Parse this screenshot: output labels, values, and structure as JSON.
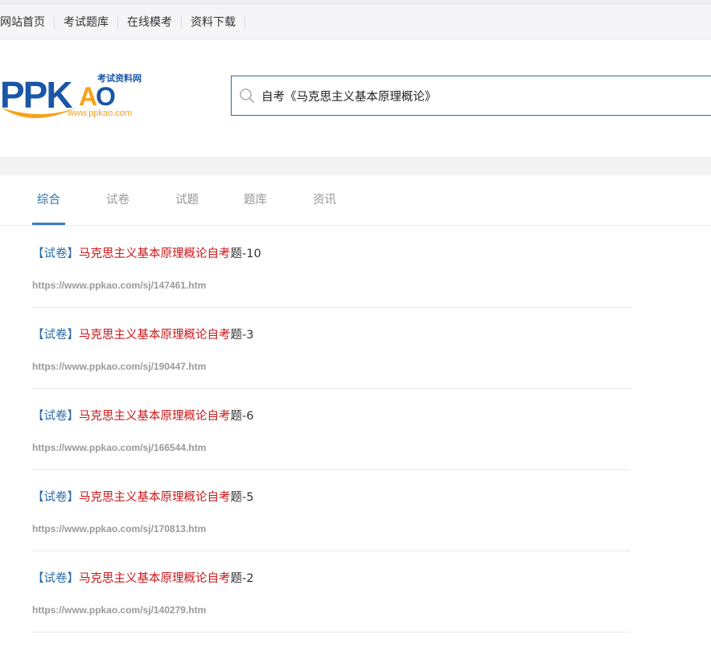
{
  "topnav": {
    "items": [
      "网站首页",
      "考试题库",
      "在线模考",
      "资料下载"
    ]
  },
  "logo": {
    "brand": "PPKAO",
    "tagline": "考试资料网",
    "url": "www.ppkao.com",
    "colors": {
      "blue": "#1a56a8",
      "orange": "#f4a31a"
    }
  },
  "search": {
    "value": "自考《马克思主义基本原理概论》",
    "icon": "search-icon"
  },
  "tabs": [
    {
      "label": "综合",
      "active": true
    },
    {
      "label": "试卷",
      "active": false
    },
    {
      "label": "试题",
      "active": false
    },
    {
      "label": "题库",
      "active": false
    },
    {
      "label": "资讯",
      "active": false
    }
  ],
  "results": [
    {
      "tag": "【试卷】",
      "keyword": "马克思主义基本原理概论自考",
      "suffix": "题-10",
      "url": "https://www.ppkao.com/sj/147461.htm"
    },
    {
      "tag": "【试卷】",
      "keyword": "马克思主义基本原理概论自考",
      "suffix": "题-3",
      "url": "https://www.ppkao.com/sj/190447.htm"
    },
    {
      "tag": "【试卷】",
      "keyword": "马克思主义基本原理概论自考",
      "suffix": "题-6",
      "url": "https://www.ppkao.com/sj/166544.htm"
    },
    {
      "tag": "【试卷】",
      "keyword": "马克思主义基本原理概论自考",
      "suffix": "题-5",
      "url": "https://www.ppkao.com/sj/170813.htm"
    },
    {
      "tag": "【试卷】",
      "keyword": "马克思主义基本原理概论自考",
      "suffix": "题-2",
      "url": "https://www.ppkao.com/sj/140279.htm"
    }
  ],
  "colors": {
    "accent": "#2b6ca8",
    "keyword": "#c9181b",
    "url": "#9a9a9a"
  }
}
